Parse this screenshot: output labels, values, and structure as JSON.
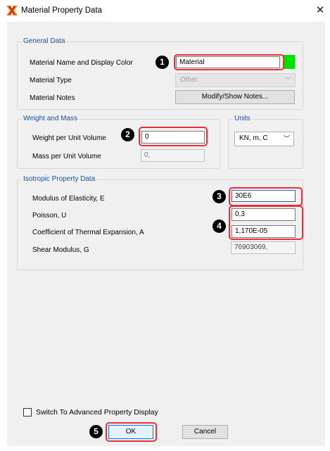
{
  "window": {
    "title": "Material Property Data",
    "close_glyph": "✕",
    "icon": "etabs-app-icon"
  },
  "general_data": {
    "legend": "General Data",
    "name_label": "Material Name and Display Color",
    "name_value": "Material",
    "display_color": "#00e000",
    "type_label": "Material Type",
    "type_value": "Other",
    "notes_label": "Material Notes",
    "notes_button": "Modify/Show Notes..."
  },
  "weight_mass": {
    "legend": "Weight and Mass",
    "weight_label": "Weight per Unit Volume",
    "weight_value": "0",
    "mass_label": "Mass per Unit Volume",
    "mass_value": "0,"
  },
  "units": {
    "legend": "Units",
    "value": "KN, m, C"
  },
  "isotropic": {
    "legend": "Isotropic Property Data",
    "modulus_label": "Modulus of Elasticity, E",
    "modulus_value": "30E6",
    "poisson_label": "Poisson, U",
    "poisson_value": "0,3",
    "thermal_label": "Coefficient of Thermal Expansion, A",
    "thermal_value": "1,170E-05",
    "shear_label": "Shear Modulus, G",
    "shear_value": "76903069,"
  },
  "advanced": {
    "label": "Switch To Advanced Property Display",
    "checked": false
  },
  "buttons": {
    "ok": "OK",
    "cancel": "Cancel"
  },
  "badges": [
    "1",
    "2",
    "3",
    "4",
    "5"
  ],
  "colors": {
    "legend_blue": "#1a4fa3",
    "highlight_red": "#e8303a",
    "color_swatch": "#00e000"
  }
}
